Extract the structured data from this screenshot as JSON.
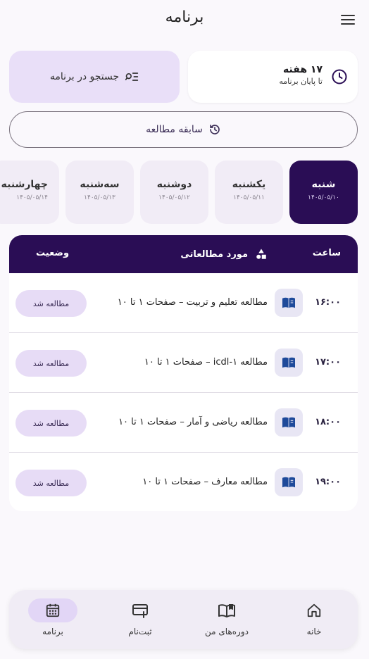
{
  "header": {
    "title": "برنامه"
  },
  "weeks_card": {
    "value": "۱۷ هفته",
    "subtitle": "تا پایان برنامه"
  },
  "search": {
    "label": "جستجو در برنامه"
  },
  "history": {
    "label": "سابقه مطالعه"
  },
  "days": [
    {
      "name": "شنبه",
      "date": "۱۴۰۵/۰۵/۱۰",
      "active": true
    },
    {
      "name": "یکشنبه",
      "date": "۱۴۰۵/۰۵/۱۱",
      "active": false
    },
    {
      "name": "دوشنبه",
      "date": "۱۴۰۵/۰۵/۱۲",
      "active": false
    },
    {
      "name": "سه‌شنبه",
      "date": "۱۴۰۵/۰۵/۱۳",
      "active": false
    },
    {
      "name": "چهارشنبه",
      "date": "۱۴۰۵/۰۵/۱۴",
      "active": false
    }
  ],
  "table": {
    "headers": {
      "time": "ساعت",
      "item": "مورد مطالعاتی",
      "status": "وضعیت"
    },
    "rows": [
      {
        "time": "۱۶:۰۰",
        "subject": "مطالعه تعلیم و تربیت – صفحات ۱ تا ۱۰",
        "status": "مطالعه شد"
      },
      {
        "time": "۱۷:۰۰",
        "subject": "مطالعه icdl-۱ – صفحات ۱ تا ۱۰",
        "status": "مطالعه شد"
      },
      {
        "time": "۱۸:۰۰",
        "subject": "مطالعه ریاضی و آمار – صفحات ۱ تا ۱۰",
        "status": "مطالعه شد"
      },
      {
        "time": "۱۹:۰۰",
        "subject": "مطالعه معارف – صفحات ۱ تا ۱۰",
        "status": "مطالعه شد"
      }
    ]
  },
  "nav": [
    {
      "label": "خانه",
      "icon": "home-icon",
      "active": false
    },
    {
      "label": "دوره‌های من",
      "icon": "book-open-icon",
      "active": false
    },
    {
      "label": "ثبت‌نام",
      "icon": "card-add-icon",
      "active": false
    },
    {
      "label": "برنامه",
      "icon": "calendar-icon",
      "active": true
    }
  ],
  "colors": {
    "primary": "#2a0d55",
    "accent_light": "#e9dff8",
    "book_icon": "#1e4a9a"
  }
}
